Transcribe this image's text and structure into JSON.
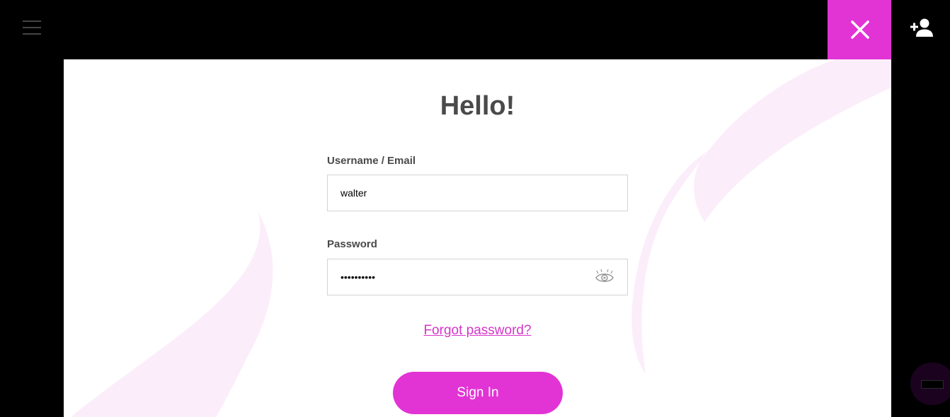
{
  "header": {
    "menu_icon": "hamburger-icon",
    "close_icon": "close-icon",
    "add_user_icon": "person-add-icon",
    "accent_color": "#e233d5"
  },
  "login": {
    "title": "Hello!",
    "username_label": "Username / Email",
    "username_value": "walter",
    "password_label": "Password",
    "password_value": "••••••••••",
    "show_password_icon": "eye-icon",
    "forgot_link": "Forgot password?",
    "signin_label": "Sign In"
  },
  "chat_widget": {
    "icon": "chat-icon"
  }
}
